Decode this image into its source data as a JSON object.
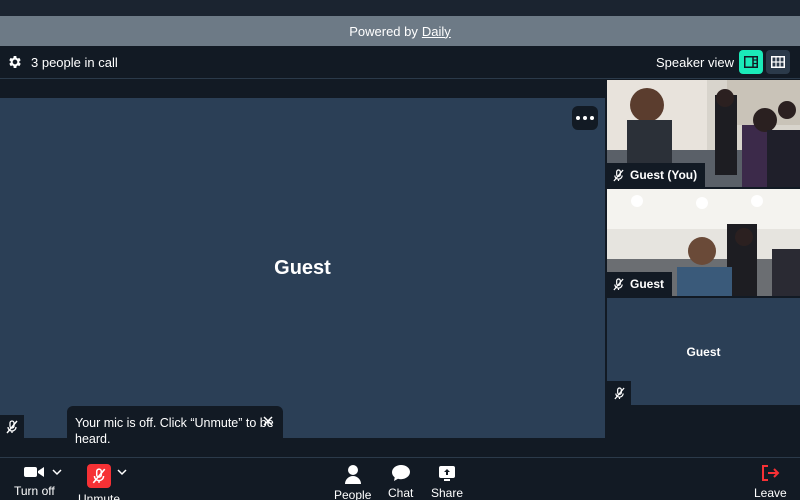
{
  "banner": {
    "prefix": "Powered by",
    "link": "Daily"
  },
  "header": {
    "people_count": "3 people in call",
    "view_label": "Speaker view"
  },
  "stage": {
    "name": "Guest"
  },
  "tiles": [
    {
      "name": "Guest (You)",
      "muted": true
    },
    {
      "name": "Guest",
      "muted": true
    },
    {
      "name": "Guest",
      "muted": true
    }
  ],
  "toast": {
    "message": "Your mic is off. Click “Unmute” to be heard."
  },
  "controls": {
    "camera": "Turn off",
    "mic": "Unmute",
    "people": "People",
    "chat": "Chat",
    "share": "Share",
    "leave": "Leave"
  },
  "colors": {
    "accent": "#1bebb9",
    "danger": "#f63135",
    "tile_bg": "#2b3f56",
    "bar_bg": "#121a24",
    "banner_bg": "#6d7a86"
  }
}
